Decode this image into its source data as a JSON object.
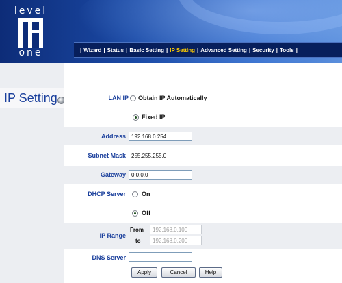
{
  "brand": {
    "logo_word_top": "level",
    "logo_word_bottom": "one"
  },
  "nav": {
    "items": [
      "Wizard",
      "Status",
      "Basic Setting",
      "IP Setting",
      "Advanced Setting",
      "Security",
      "Tools"
    ],
    "active": "IP Setting",
    "separator": "|"
  },
  "page": {
    "title": "IP Setting"
  },
  "form": {
    "lan_ip": {
      "label": "LAN IP",
      "option_auto": "Obtain IP Automatically",
      "option_fixed": "Fixed IP",
      "selected": "Fixed IP"
    },
    "address": {
      "label": "Address",
      "value": "192.168.0.254"
    },
    "subnet_mask": {
      "label": "Subnet Mask",
      "value": "255.255.255.0"
    },
    "gateway": {
      "label": "Gateway",
      "value": "0.0.0.0"
    },
    "dhcp_server": {
      "label": "DHCP Server",
      "option_on": "On",
      "option_off": "Off",
      "selected": "Off"
    },
    "ip_range": {
      "label": "IP Range",
      "from_label": "From",
      "to_label": "to",
      "from_value": "192.168.0.100",
      "to_value": "192.168.0.200"
    },
    "dns_server": {
      "label": "DNS Server",
      "value": ""
    }
  },
  "buttons": {
    "apply": "Apply",
    "cancel": "Cancel",
    "help": "Help"
  },
  "colors": {
    "label_blue": "#1a3f9c",
    "nav_active": "#ffcc00",
    "header_dark": "#0d2c78"
  }
}
